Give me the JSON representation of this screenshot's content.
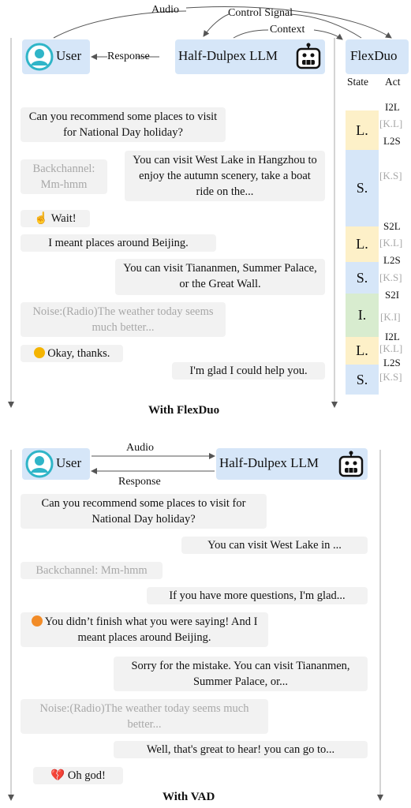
{
  "top": {
    "labels": {
      "audio": "Audio",
      "control_signal": "Control Signal",
      "context": "Context",
      "response": "Response"
    },
    "user_label": "User",
    "llm_label": "Half-Dulpex LLM",
    "flexduo_label": "FlexDuo",
    "state_header": "State",
    "act_header": "Act",
    "messages": [
      {
        "text": "Can you recommend some places to visit for  National Day holiday?",
        "style": "normal"
      },
      {
        "text": "Backchannel: Mm-hmm",
        "style": "muted"
      },
      {
        "text": "You can visit West Lake in Hangzhou to enjoy the autumn scenery, take a boat ride on the...",
        "style": "normal"
      },
      {
        "text": "Wait!",
        "style": "normal",
        "icon": "pointing-finger-icon"
      },
      {
        "text": "I meant places around Beijing.",
        "style": "normal"
      },
      {
        "text": "You can visit Tiananmen, Summer Palace, or the Great Wall.",
        "style": "normal"
      },
      {
        "text": "Noise:(Radio)The weather today seems much better...",
        "style": "muted"
      },
      {
        "text": "Okay, thanks.",
        "style": "normal",
        "icon": "smile-emoji-icon"
      },
      {
        "text": "I'm glad I could help you.",
        "style": "normal"
      }
    ],
    "states": [
      {
        "label": "L.",
        "color": "#fdf0c8"
      },
      {
        "label": "S.",
        "color": "#d6e6f8"
      },
      {
        "label": "L.",
        "color": "#fdf0c8"
      },
      {
        "label": "S.",
        "color": "#d6e6f8"
      },
      {
        "label": "I.",
        "color": "#d8eccf"
      },
      {
        "label": "L.",
        "color": "#fdf0c8"
      },
      {
        "label": "S.",
        "color": "#d6e6f8"
      }
    ],
    "acts": [
      "I2L",
      "[K.L]",
      "L2S",
      "[K.S]",
      "S2L",
      "[K.L]",
      "L2S",
      "[K.S]",
      "S2I",
      "[K.I]",
      "I2L",
      "[K.L]",
      "L2S",
      "[K.S]"
    ],
    "caption": "With FlexDuo"
  },
  "bottom": {
    "labels": {
      "audio": "Audio",
      "response": "Response"
    },
    "user_label": "User",
    "llm_label": "Half-Dulpex LLM",
    "messages": [
      {
        "text": "Can you recommend some places to visit for  National Day holiday?",
        "style": "normal"
      },
      {
        "text": "You can visit West Lake in ...",
        "style": "normal"
      },
      {
        "text": "Backchannel: Mm-hmm",
        "style": "muted"
      },
      {
        "text": "If you have more questions, I'm glad...",
        "style": "normal"
      },
      {
        "text": "You didn’t finish what you were saying! And I meant places around Beijing.",
        "style": "normal",
        "icon": "angry-emoji-icon"
      },
      {
        "text": "Sorry for the mistake. You can visit Tiananmen, Summer Palace, or...",
        "style": "normal"
      },
      {
        "text": "Noise:(Radio)The weather today seems much better...",
        "style": "muted"
      },
      {
        "text": "Well, that's great to hear! you can go to...",
        "style": "normal"
      },
      {
        "text": "Oh god!",
        "style": "normal",
        "icon": "broken-heart-icon"
      }
    ],
    "caption": "With VAD"
  },
  "colors": {
    "node_blue": "#d6e6f8",
    "bubble_gray": "#f2f2f2",
    "muted_text": "#a8a8a8",
    "listen": "#fdf0c8",
    "speak": "#d6e6f8",
    "idle": "#d8eccf"
  }
}
